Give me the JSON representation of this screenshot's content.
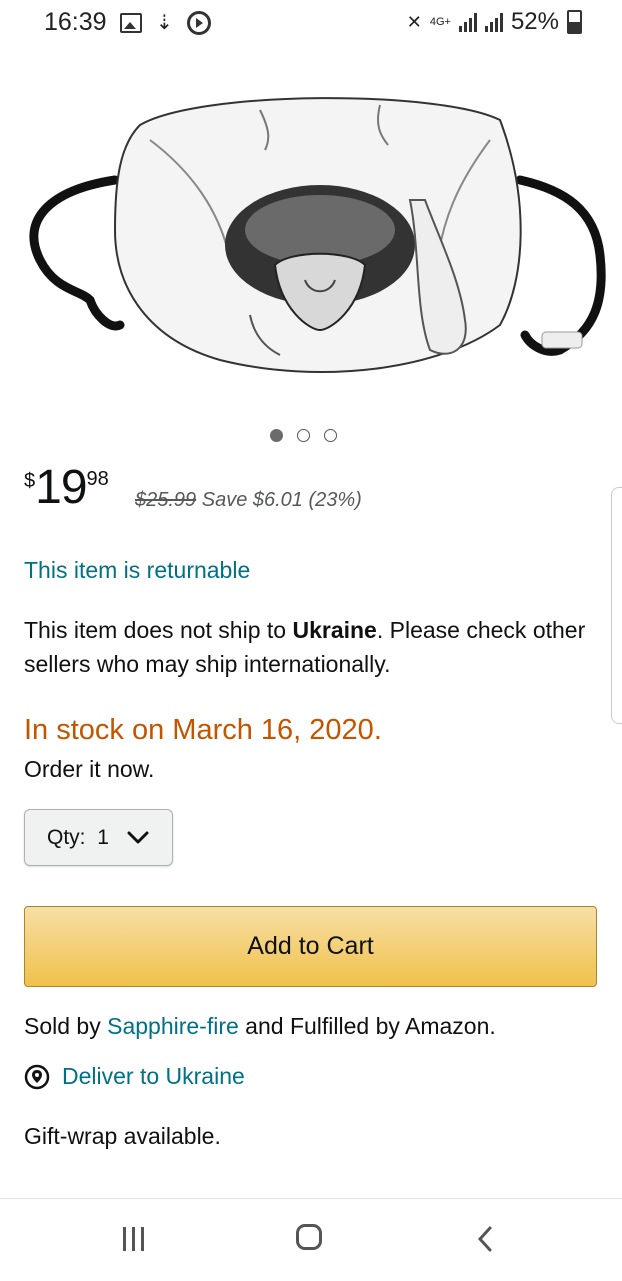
{
  "status_bar": {
    "time": "16:39",
    "network": "4G+",
    "battery": "52%"
  },
  "carousel": {
    "image_icon": "mask-product-image",
    "pages": 3,
    "active_page": 1
  },
  "price": {
    "currency": "$",
    "whole": "19",
    "fraction": "98",
    "list_price": "$25.99",
    "savings": "Save $6.01 (23%)"
  },
  "returnable_label": "This item is returnable",
  "shipping": {
    "prefix": "This item does not ship to ",
    "country": "Ukraine",
    "suffix": ". Please check other sellers who may ship internationally."
  },
  "stock": {
    "status": "In stock on March 16, 2020.",
    "note": "Order it now."
  },
  "quantity": {
    "label": "Qty:",
    "value": "1"
  },
  "add_to_cart_label": "Add to Cart",
  "seller": {
    "prefix": "Sold by ",
    "name": "Sapphire-fire",
    "suffix": " and Fulfilled by Amazon."
  },
  "deliver_label": "Deliver to Ukraine",
  "gift_label": "Gift-wrap available.",
  "colors": {
    "link": "#007185",
    "stock": "#c45500",
    "cart_button": "#f0c14b"
  }
}
